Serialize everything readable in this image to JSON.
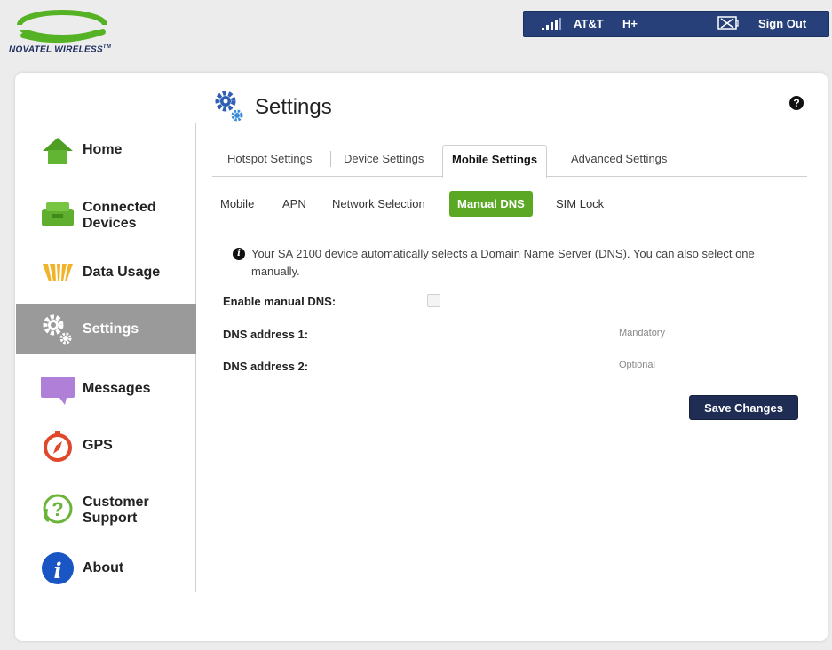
{
  "brand": {
    "logo_text": "NOVATEL WIRELESS",
    "logo_tm": "TM"
  },
  "status_bar": {
    "carrier": "AT&T",
    "network_type": "H+",
    "signout_label": "Sign Out"
  },
  "sidebar": {
    "items": [
      {
        "label": "Home",
        "icon": "home-icon",
        "active": false
      },
      {
        "label": "Connected\nDevices",
        "icon": "connected-devices-icon",
        "active": false
      },
      {
        "label": "Data Usage",
        "icon": "data-usage-icon",
        "active": false
      },
      {
        "label": "Settings",
        "icon": "settings-icon",
        "active": true
      },
      {
        "label": "Messages",
        "icon": "messages-icon",
        "active": false
      },
      {
        "label": "GPS",
        "icon": "gps-icon",
        "active": false
      },
      {
        "label": "Customer\nSupport",
        "icon": "customer-support-icon",
        "active": false
      },
      {
        "label": "About",
        "icon": "about-icon",
        "active": false
      }
    ]
  },
  "header": {
    "title": "Settings",
    "help_symbol": "?"
  },
  "tabs": [
    {
      "label": "Hotspot Settings",
      "active": false
    },
    {
      "label": "Device Settings",
      "active": false
    },
    {
      "label": "Mobile Settings",
      "active": true
    },
    {
      "label": "Advanced Settings",
      "active": false
    }
  ],
  "subtabs": [
    {
      "label": "Mobile",
      "active": false
    },
    {
      "label": "APN",
      "active": false
    },
    {
      "label": "Network Selection",
      "active": false
    },
    {
      "label": "Manual DNS",
      "active": true
    },
    {
      "label": "SIM Lock",
      "active": false
    }
  ],
  "content": {
    "info_text": "Your SA 2100 device automatically selects a Domain Name Server (DNS). You can also select one manually.",
    "enable_label": "Enable manual DNS:",
    "enable_checked": false,
    "dns1": {
      "label": "DNS address 1:",
      "value": "",
      "placeholder": "Mandatory"
    },
    "dns2": {
      "label": "DNS address 2:",
      "value": "",
      "placeholder": "Optional"
    },
    "save_label": "Save Changes"
  },
  "colors": {
    "status_bar": "#27407a",
    "active_nav": "#9a9a9a",
    "active_subtab": "#5aa824",
    "save_button": "#1f2d55"
  }
}
